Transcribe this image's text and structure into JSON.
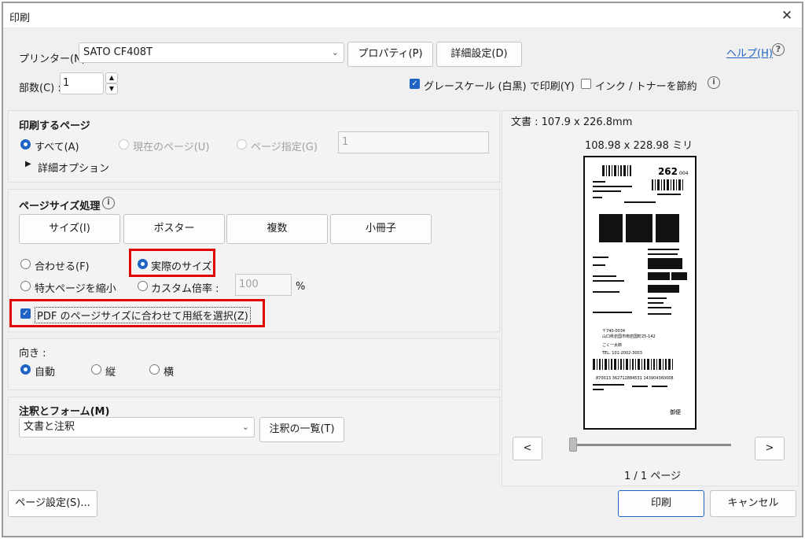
{
  "window": {
    "title": "印刷",
    "close_icon": "close-icon"
  },
  "printer": {
    "label": "プリンター(N) :",
    "value": "SATO CF408T",
    "properties_button": "プロパティ(P)",
    "advanced_button": "詳細設定(D)",
    "help_link": "ヘルプ(H)"
  },
  "copies": {
    "label": "部数(C) :",
    "value": "1"
  },
  "options": {
    "grayscale_label": "グレースケール (白黒) で印刷(Y)",
    "grayscale_checked": true,
    "save_ink_label": "インク / トナーを節約",
    "save_ink_checked": false
  },
  "pages": {
    "title": "印刷するページ",
    "all_label": "すべて(A)",
    "current_label": "現在のページ(U)",
    "range_label": "ページ指定(G)",
    "range_value": "1",
    "more_options": "詳細オプション"
  },
  "page_size": {
    "title": "ページサイズ処理",
    "tabs": [
      "サイズ(I)",
      "ポスター",
      "複数",
      "小冊子"
    ],
    "fit_label": "合わせる(F)",
    "actual_label": "実際のサイズ",
    "shrink_label": "特大ページを縮小",
    "custom_label": "カスタム倍率 :",
    "custom_value": "100",
    "custom_unit": "%",
    "pdf_paper_label": "PDF のページサイズに合わせて用紙を選択(Z)",
    "pdf_paper_checked": true
  },
  "orientation": {
    "title": "向き :",
    "auto_label": "自動",
    "portrait_label": "縦",
    "landscape_label": "横"
  },
  "comments": {
    "title": "注釈とフォーム(M)",
    "value": "文書と注釈",
    "summary_button": "注釈の一覧(T)"
  },
  "preview": {
    "doc_size": "文書 : 107.9 x 226.8mm",
    "paper_size": "108.98 x 228.98 ミリ",
    "page_counter": "1 / 1 ページ",
    "prev_button": "<",
    "next_button": ">",
    "slider_position": 0,
    "label_number": "262",
    "label_suffix": "004",
    "label_postcode": "〒740-0034",
    "label_address": "山口県岩国市南岩国町25-142",
    "label_name": "ごく一太郎",
    "label_tel": "TEL: 101-2002-3003",
    "label_barcode_text": "870013 362712884531 143904360008",
    "label_footer": "御便"
  },
  "footer": {
    "page_setup_button": "ページ設定(S)...",
    "print_button": "印刷",
    "cancel_button": "キャンセル"
  },
  "colors": {
    "accent": "#1f63c4",
    "highlight": "#e00000"
  }
}
